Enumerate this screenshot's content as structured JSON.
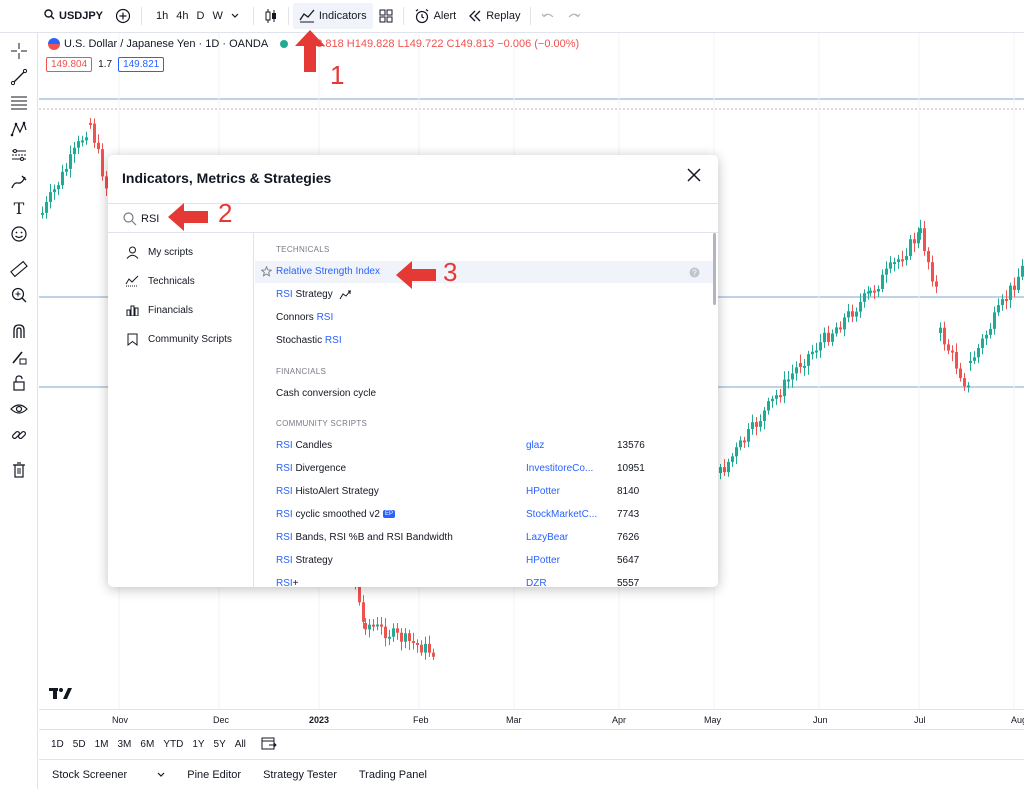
{
  "toolbar": {
    "symbol": "USDJPY",
    "intervals": [
      "1h",
      "4h",
      "D",
      "W"
    ],
    "indicators_label": "Indicators",
    "alert_label": "Alert",
    "replay_label": "Replay"
  },
  "legend": {
    "title": "U.S. Dollar / Japanese Yen · 1D · OANDA",
    "ohlc": "3.818 H149.828 L149.722 C149.813 −0.006 (−0.00%)",
    "bid": "149.804",
    "spread": "1.7",
    "ask": "149.821"
  },
  "time_axis": [
    "Nov",
    "Dec",
    "2023",
    "Feb",
    "Mar",
    "Apr",
    "May",
    "Jun",
    "Jul",
    "Aug"
  ],
  "ranges": [
    "1D",
    "5D",
    "1M",
    "3M",
    "6M",
    "YTD",
    "1Y",
    "5Y",
    "All"
  ],
  "bottom_tabs": [
    "Stock Screener",
    "Pine Editor",
    "Strategy Tester",
    "Trading Panel"
  ],
  "dialog": {
    "title": "Indicators, Metrics & Strategies",
    "search_value": "RSI",
    "sidebar": [
      "My scripts",
      "Technicals",
      "Financials",
      "Community Scripts"
    ],
    "sections": {
      "technicals": "TECHNICALS",
      "financials": "FINANCIALS",
      "community": "COMMUNITY SCRIPTS"
    },
    "technicals": [
      "Relative Strength Index",
      "RSI Strategy",
      "Connors RSI",
      "Stochastic RSI"
    ],
    "financials": [
      "Cash conversion cycle"
    ],
    "community": [
      {
        "name": "RSI Candles",
        "author": "glaz",
        "likes": "13576"
      },
      {
        "name": "RSI Divergence",
        "author": "InvestitoreCo...",
        "likes": "10951"
      },
      {
        "name": "RSI HistoAlert Strategy",
        "author": "HPotter",
        "likes": "8140"
      },
      {
        "name": "RSI cyclic smoothed v2",
        "author": "StockMarketC...",
        "likes": "7743",
        "badge": "EP"
      },
      {
        "name": "RSI Bands, RSI %B and RSI Bandwidth",
        "author": "LazyBear",
        "likes": "7626"
      },
      {
        "name": "RSI Strategy",
        "author": "HPotter",
        "likes": "5647"
      },
      {
        "name": "RSI+",
        "author": "DZR",
        "likes": "5557"
      }
    ]
  },
  "annotations": [
    "1",
    "2",
    "3"
  ],
  "colors": {
    "accent": "#2962ff",
    "up": "#22ab94",
    "down": "#ef5350",
    "arrow": "#e53935"
  }
}
